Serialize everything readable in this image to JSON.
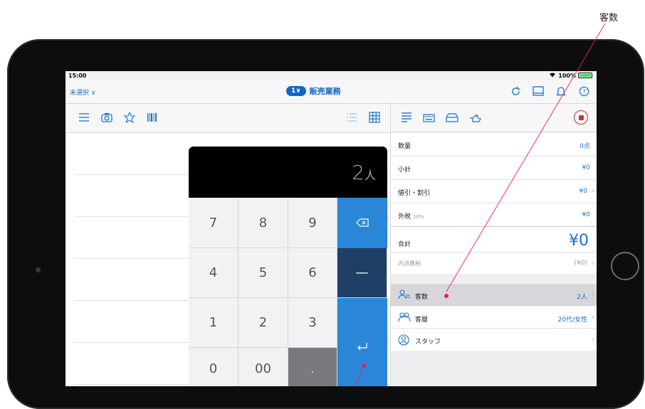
{
  "callout": {
    "label": "客数"
  },
  "status_bar": {
    "time": "15:00",
    "battery": "100%"
  },
  "nav": {
    "left": "未選択 ∨",
    "badge": "1∨",
    "title": "販売業務",
    "icons": [
      "refresh-icon",
      "layout-icon",
      "bell-icon",
      "help-icon"
    ]
  },
  "left_toolbar": {
    "icons": [
      "list-icon",
      "camera-icon",
      "star-icon",
      "barcode-icon"
    ],
    "right_icons": [
      "list-view-icon",
      "grid-view-icon"
    ]
  },
  "right_toolbar": {
    "icons": [
      "menu-icon",
      "keyboard-icon",
      "drawer-icon",
      "hand-icon"
    ],
    "stop": "stop-icon"
  },
  "summary": {
    "quantity_label": "数量",
    "quantity_value": "0点",
    "subtotal_label": "小計",
    "subtotal_value": "¥0",
    "discount_label": "値引・割引",
    "discount_value": "¥0",
    "tax_label": "外税",
    "tax_rate": "10%",
    "tax_value": "¥0",
    "total_label": "合計",
    "total_value": "¥0",
    "inner_tax_label": "内消費税",
    "inner_tax_value": "(¥0)"
  },
  "customer": {
    "count_label": "客数",
    "count_value": "2人",
    "segment_label": "客層",
    "segment_value": "20代/女性",
    "staff_label": "スタッフ"
  },
  "keypad": {
    "display_number": "2",
    "display_unit": "人",
    "keys": [
      "7",
      "8",
      "9",
      "4",
      "5",
      "6",
      "1",
      "2",
      "3",
      "0",
      "00",
      "."
    ],
    "backspace": "⌫",
    "minus": "—",
    "enter": "⏎"
  },
  "colors": {
    "accent": "#1a73c8",
    "brand": "#1565c0",
    "stop": "#d32f2f",
    "marker": "#e91e63"
  }
}
